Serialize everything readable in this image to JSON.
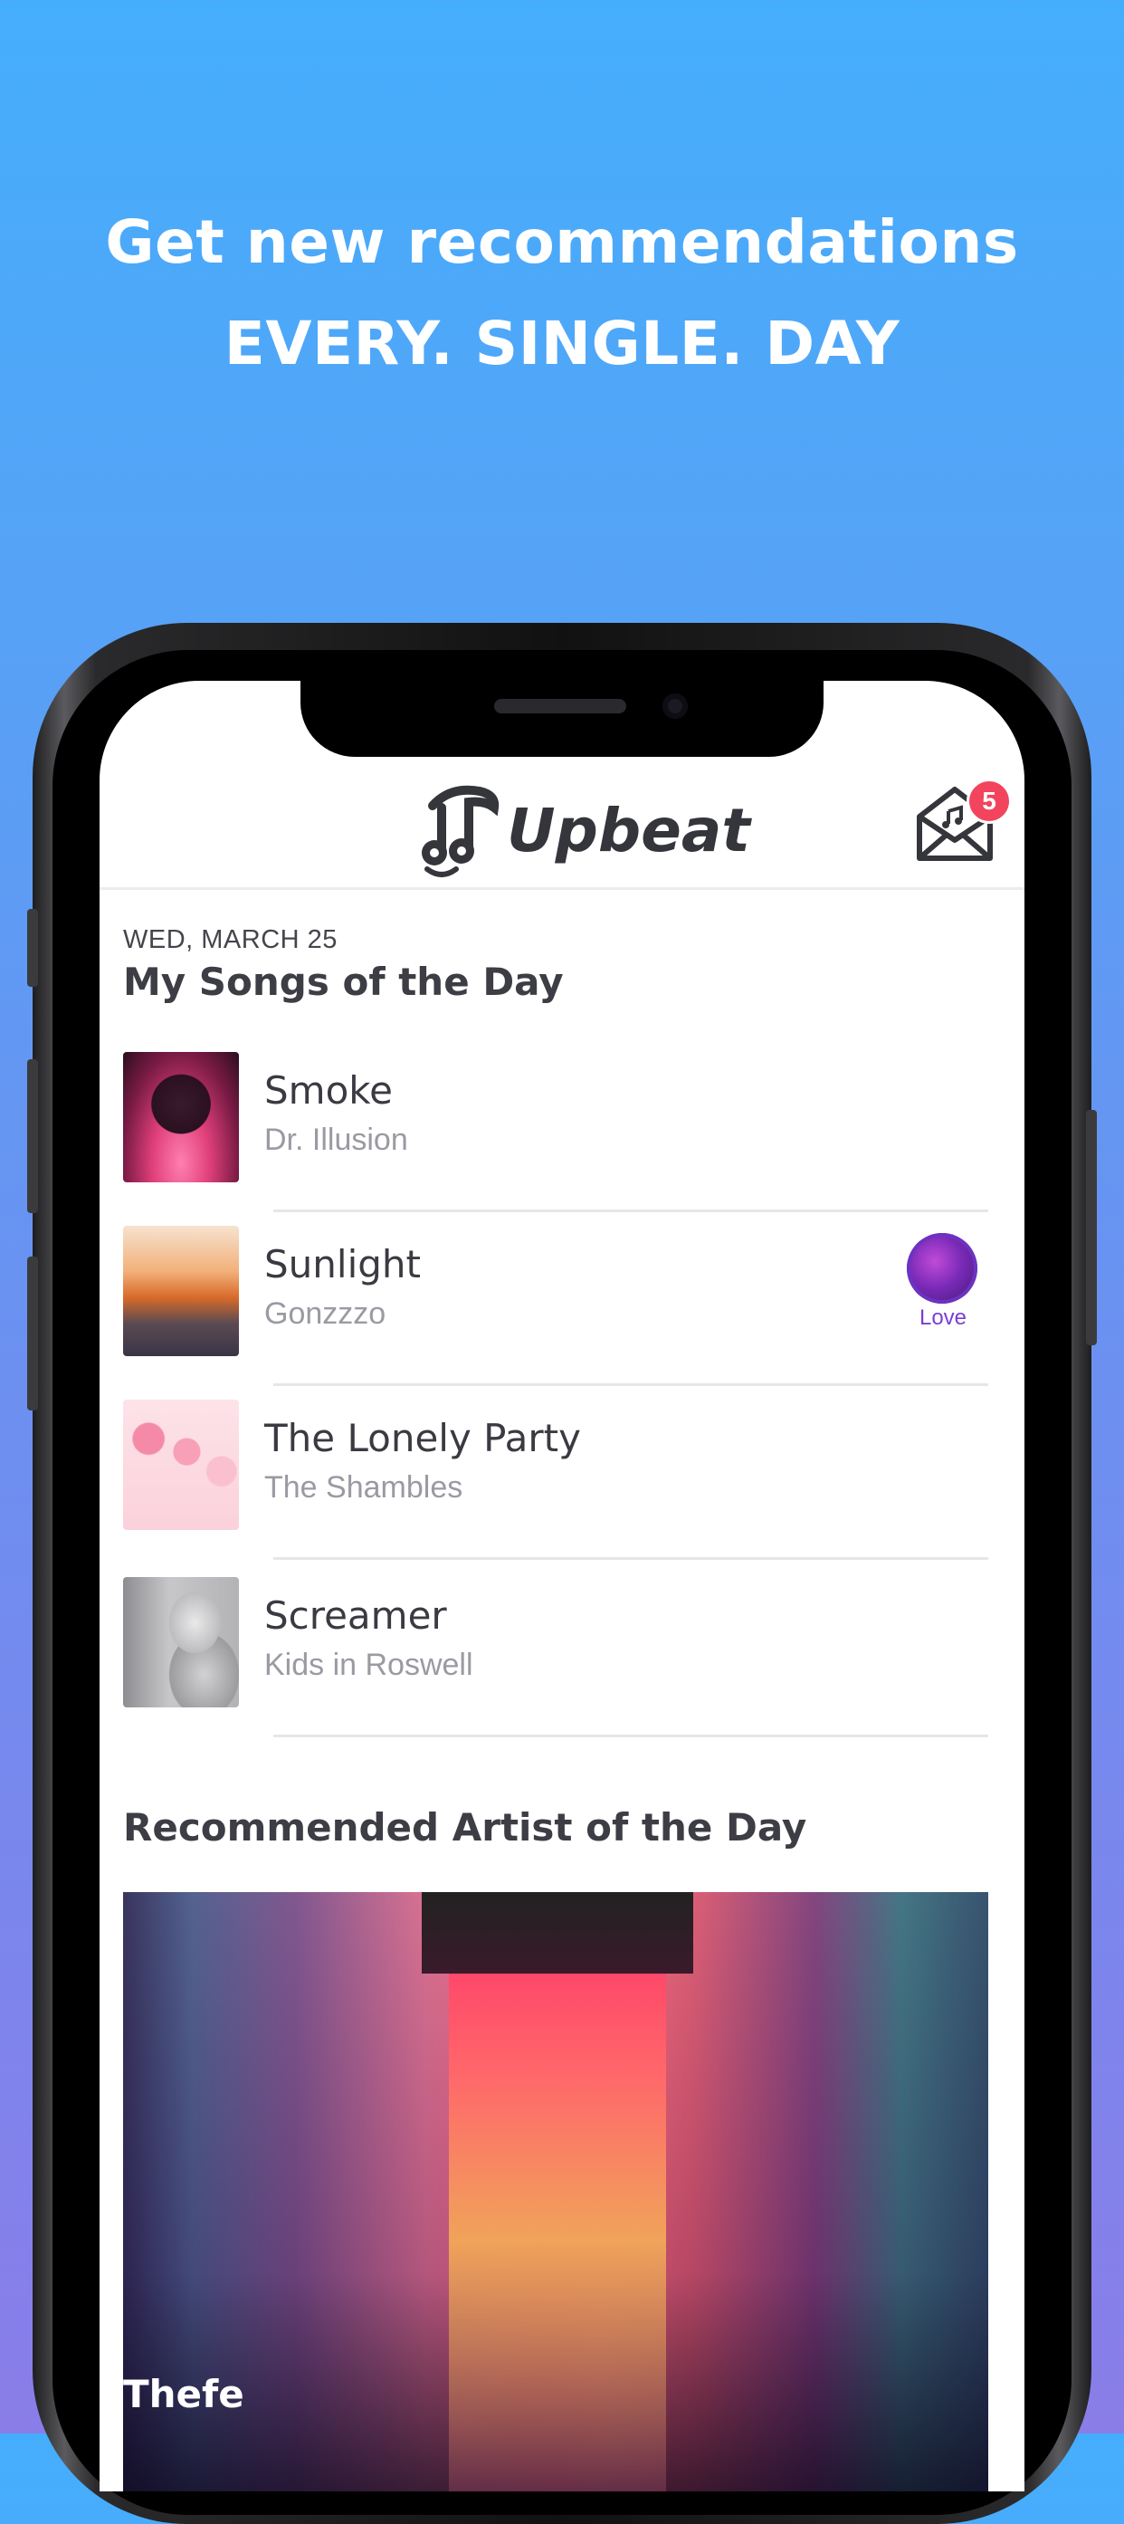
{
  "headline": {
    "line1": "Get new recommendations",
    "line2": "EVERY. SINGLE. DAY"
  },
  "app": {
    "name": "Upbeat",
    "inbox_badge": "5"
  },
  "songs_section": {
    "date": "WED, MARCH 25",
    "title": "My Songs of the Day",
    "songs": [
      {
        "title": "Smoke",
        "artist": "Dr. Illusion"
      },
      {
        "title": "Sunlight",
        "artist": "Gonzzzo",
        "reaction": "Love"
      },
      {
        "title": "The Lonely Party",
        "artist": "The Shambles"
      },
      {
        "title": "Screamer",
        "artist": "Kids in Roswell"
      }
    ]
  },
  "artist_section": {
    "title": "Recommended Artist of the Day",
    "artist_name": "Thefe"
  },
  "colors": {
    "background_top": "#45aefc",
    "background_bottom": "#8a7de8",
    "badge": "#f2455d",
    "love_accent": "#7b3fd1"
  }
}
